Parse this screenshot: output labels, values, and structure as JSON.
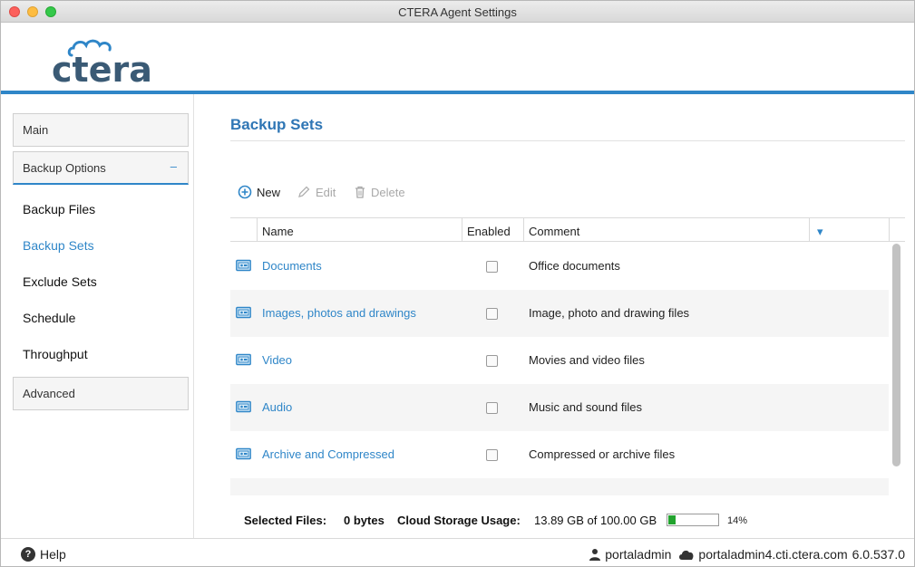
{
  "window": {
    "title": "CTERA Agent Settings"
  },
  "brand": {
    "logo_text": "ctera",
    "accent": "#2f86c8",
    "logo_color": "#3a5a75"
  },
  "sidebar": {
    "main_label": "Main",
    "backup_options_label": "Backup Options",
    "backup_options_toggle": "–",
    "items": [
      {
        "label": "Backup Files",
        "active": false
      },
      {
        "label": "Backup Sets",
        "active": true
      },
      {
        "label": "Exclude Sets",
        "active": false
      },
      {
        "label": "Schedule",
        "active": false
      },
      {
        "label": "Throughput",
        "active": false
      }
    ],
    "advanced_label": "Advanced"
  },
  "page": {
    "title": "Backup Sets"
  },
  "toolbar": {
    "new_label": "New",
    "edit_label": "Edit",
    "delete_label": "Delete"
  },
  "table": {
    "columns": {
      "name": "Name",
      "enabled": "Enabled",
      "comment": "Comment",
      "sort_icon": "▾"
    },
    "rows": [
      {
        "name": "Documents",
        "enabled": false,
        "comment": "Office documents"
      },
      {
        "name": "Images, photos and drawings",
        "enabled": false,
        "comment": "Image, photo and drawing files"
      },
      {
        "name": "Video",
        "enabled": false,
        "comment": "Movies and video files"
      },
      {
        "name": "Audio",
        "enabled": false,
        "comment": "Music and sound files"
      },
      {
        "name": "Archive and Compressed",
        "enabled": false,
        "comment": "Compressed or archive files"
      }
    ]
  },
  "status": {
    "selected_files_label": "Selected Files:",
    "selected_files_value": "0 bytes",
    "cloud_usage_label": "Cloud Storage Usage:",
    "cloud_usage_value": "13.89 GB of 100.00 GB",
    "usage_percent_text": "14%",
    "usage_fraction": 0.14
  },
  "footer": {
    "help_label": "Help",
    "user": "portaladmin",
    "server": "portaladmin4.cti.ctera.com",
    "version": "6.0.537.0"
  }
}
